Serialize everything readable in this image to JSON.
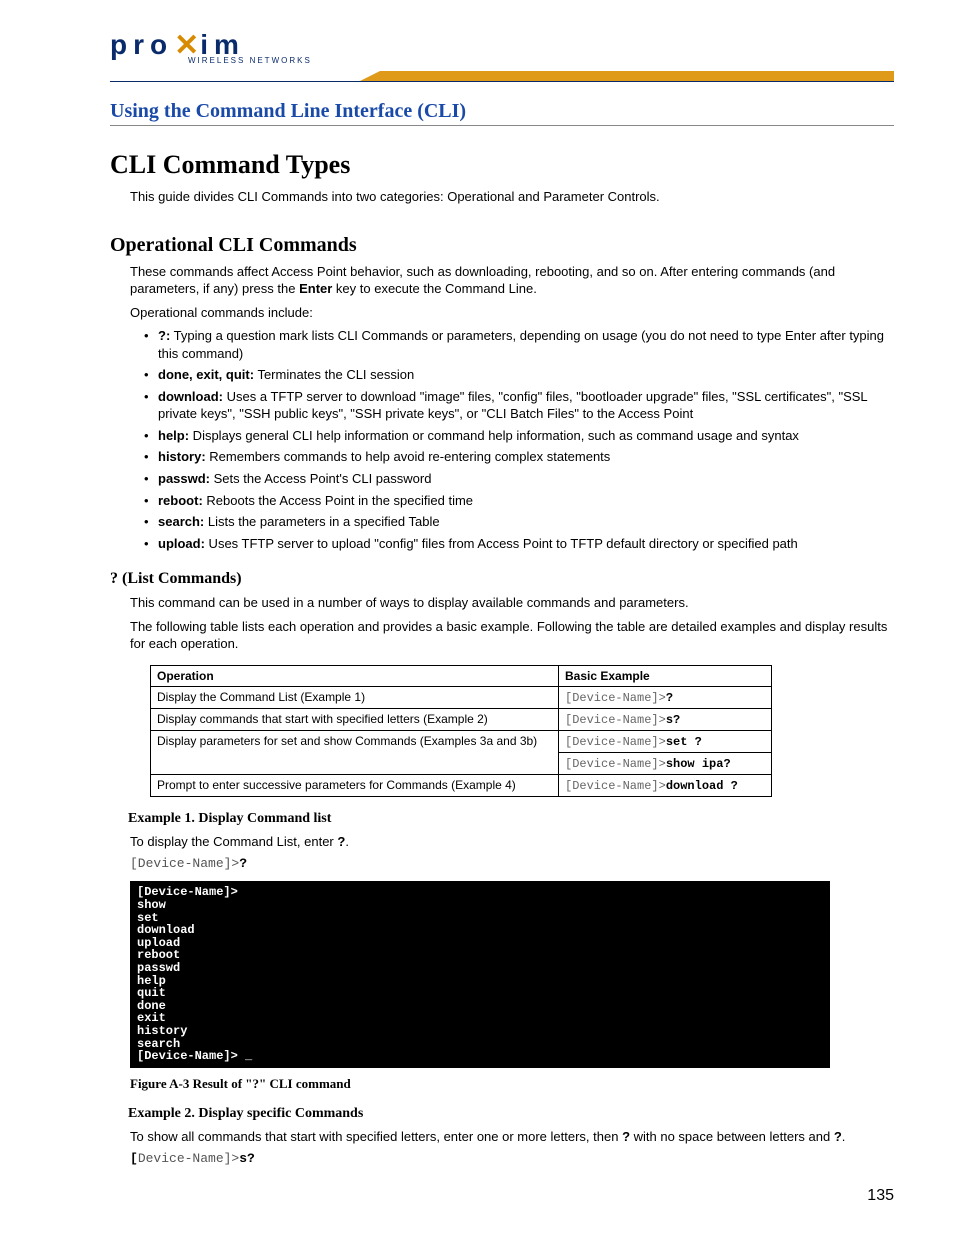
{
  "logo": {
    "text": "pro",
    "text2": "im",
    "sub": "WIRELESS NETWORKS"
  },
  "section_title": "Using the Command Line Interface (CLI)",
  "h1": "CLI Command Types",
  "intro": "This guide divides CLI Commands into two categories: Operational and Parameter Controls.",
  "h2": "Operational CLI Commands",
  "op_intro1_a": "These commands affect Access Point behavior, such as downloading, rebooting, and so on. After entering commands (and parameters, if any) press the ",
  "op_intro1_b": "Enter",
  "op_intro1_c": " key to execute the Command Line.",
  "op_intro2": "Operational commands include:",
  "list": [
    {
      "b": "?:",
      "t": " Typing a question mark lists CLI Commands or parameters, depending on usage (you do not need to type Enter after typing this command)"
    },
    {
      "b": "done, exit, quit:",
      "t": " Terminates the CLI session"
    },
    {
      "b": "download:",
      "t": " Uses a TFTP server to download \"image\" files, \"config\" files, \"bootloader upgrade\" files, \"SSL certificates\", \"SSL private keys\", \"SSH public keys\", \"SSH private keys\", or \"CLI Batch Files\" to the Access Point"
    },
    {
      "b": "help:",
      "t": " Displays general CLI help information or command help information, such as command usage and syntax"
    },
    {
      "b": "history:",
      "t": " Remembers commands to help avoid re-entering complex statements"
    },
    {
      "b": "passwd:",
      "t": " Sets the Access Point's CLI password"
    },
    {
      "b": "reboot:",
      "t": " Reboots the Access Point in the specified time"
    },
    {
      "b": "search:",
      "t": " Lists the parameters in a specified Table"
    },
    {
      "b": "upload:",
      "t": " Uses TFTP server to upload \"config\" files from Access Point to TFTP default directory or specified path"
    }
  ],
  "h3": "? (List Commands)",
  "lc_p1": "This command can be used in a number of ways to display available commands and parameters.",
  "lc_p2": "The following table lists each operation and provides a basic example. Following the table are detailed examples and display results for each operation.",
  "table": {
    "head": {
      "c1": "Operation",
      "c2": "Basic Example"
    },
    "rows": [
      {
        "op": "Display the Command List (Example 1)",
        "ex": [
          {
            "p": "[Device-Name]>",
            "c": "?"
          }
        ]
      },
      {
        "op": "Display commands that start with specified letters (Example 2)",
        "ex": [
          {
            "p": "[Device-Name]>",
            "c": "s?"
          }
        ]
      },
      {
        "op": "Display parameters for set and show Commands (Examples 3a and 3b)",
        "ex": [
          {
            "p": "[Device-Name]>",
            "c": "set ?"
          },
          {
            "p": "[Device-Name]>",
            "c": "show ipa?"
          }
        ]
      },
      {
        "op": "Prompt to enter successive parameters for Commands (Example 4)",
        "ex": [
          {
            "p": "[Device-Name]>",
            "c": "download ?"
          }
        ]
      }
    ]
  },
  "ex1_h": "Example 1. Display Command list",
  "ex1_p_a": "To display the Command List, enter ",
  "ex1_p_b": "?",
  "ex1_p_c": ".",
  "ex1_code_p": "[Device-Name]>",
  "ex1_code_c": "?",
  "terminal": "[Device-Name]>\nshow\nset\ndownload\nupload\nreboot\npasswd\nhelp\nquit\ndone\nexit\nhistory\nsearch\n[Device-Name]> _",
  "fig_caption": "Figure A-3    Result of \"?\" CLI command",
  "ex2_h": "Example 2. Display specific Commands",
  "ex2_p_a": "To show all commands that start with specified letters, enter one or more letters, then ",
  "ex2_p_b": "?",
  "ex2_p_c": " with no space between letters and ",
  "ex2_p_d": "?",
  "ex2_p_e": ".",
  "ex2_code_pre": "[",
  "ex2_code_p": "Device-Name]>",
  "ex2_code_c": "s?",
  "page_number": "135"
}
